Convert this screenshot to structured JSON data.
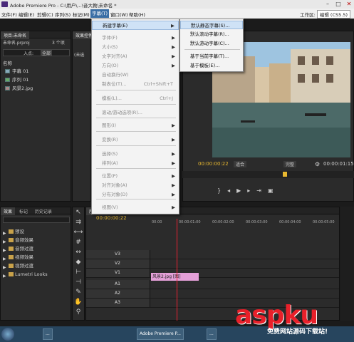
{
  "window": {
    "title": "Adobe Premiere Pro - C:\\用户\\...\\音大教\\未命名 *",
    "min": "–",
    "max": "□",
    "close": "✕"
  },
  "menubar": {
    "items": [
      "文件(F)",
      "编辑(E)",
      "剪辑(C)",
      "序列(S)",
      "标记(M)",
      "字幕(T)",
      "窗口(W)",
      "帮助(H)"
    ],
    "active_index": 5,
    "workspace_label": "工作区:",
    "workspace_value": "编辑 (CS5.5)"
  },
  "project": {
    "tabs": [
      "项目:未命名",
      "效果控件"
    ],
    "filename": "未命名.prproj",
    "count": "3 个项",
    "bin_label": "入点:",
    "bin_value": "全部",
    "name_header": "名称",
    "items": [
      "字幕 01",
      "序列 01",
      "风景2.jpg"
    ],
    "source_label": "(未选"
  },
  "dropdown": {
    "items": [
      {
        "label": "新建字幕(E)",
        "arrow": "▶",
        "enabled": true,
        "highlight": true
      },
      {
        "label": "字体(F)",
        "arrow": "▶",
        "enabled": false
      },
      {
        "label": "大小(S)",
        "arrow": "▶",
        "enabled": false
      },
      {
        "label": "文字对齐(A)",
        "arrow": "▶",
        "enabled": false
      },
      {
        "label": "方向(O)",
        "arrow": "▶",
        "enabled": false
      },
      {
        "label": "自动换行(W)",
        "arrow": "",
        "enabled": false
      },
      {
        "label": "制表位(T)...",
        "shortcut": "Ctrl+Shift+T",
        "enabled": false
      },
      {
        "label": "模板(L)...",
        "shortcut": "Ctrl+J",
        "enabled": false
      },
      {
        "label": "滚动/游动选项(R)...",
        "enabled": false
      },
      {
        "label": "图形(I)",
        "arrow": "▶",
        "enabled": false
      },
      {
        "label": "变换(R)",
        "arrow": "▶",
        "enabled": false
      },
      {
        "label": "选择(S)",
        "arrow": "▶",
        "enabled": false
      },
      {
        "label": "排列(A)",
        "arrow": "▶",
        "enabled": false
      },
      {
        "label": "位置(P)",
        "arrow": "▶",
        "enabled": false
      },
      {
        "label": "对齐对象(A)",
        "arrow": "▶",
        "enabled": false
      },
      {
        "label": "分布对象(D)",
        "arrow": "▶",
        "enabled": false
      },
      {
        "label": "视图(V)",
        "arrow": "▶",
        "enabled": false
      }
    ]
  },
  "submenu": {
    "items": [
      "默认静态字幕(S)...",
      "默认滚动字幕(R)...",
      "默认游动字幕(C)...",
      "基于当前字幕(T)...",
      "基于模板(E)..."
    ],
    "highlight_index": 0
  },
  "program": {
    "timecode": "00:00:00:22",
    "fit": "适合",
    "quality": "完整",
    "duration": "00:00:01:15"
  },
  "effects": {
    "tabs": [
      "效果",
      "标记",
      "历史记录"
    ],
    "folders": [
      "预设",
      "音频效果",
      "音频过渡",
      "视频效果",
      "视频过渡",
      "Lumetri Looks"
    ]
  },
  "timeline": {
    "tab": "序列 01",
    "timecode": "00:00:00:22",
    "ruler": [
      "00:00",
      "00:00:01:00",
      "00:00:02:00",
      "00:00:03:00",
      "00:00:04:00",
      "00:00:05:00"
    ],
    "tracks": [
      "V3",
      "V2",
      "V1",
      "A1",
      "A2",
      "A3"
    ],
    "clip_label": "风景2.jpg [图]"
  },
  "taskbar": {
    "items": [
      "...",
      "Adobe Premiere P...",
      "..."
    ]
  },
  "watermark": {
    "main": "aspku",
    "sub": "免费网站源码下载站!"
  }
}
